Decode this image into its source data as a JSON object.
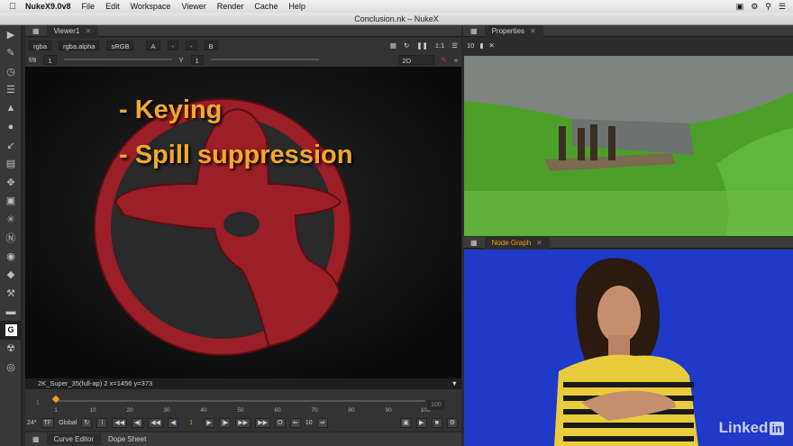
{
  "menubar": {
    "app_name": "NukeX9.0v8",
    "items": [
      "File",
      "Edit",
      "Workspace",
      "Viewer",
      "Render",
      "Cache",
      "Help"
    ]
  },
  "window_title": "Conclusion.nk – NukeX",
  "left_toolbar": {
    "tools": [
      "pointer-icon",
      "paint-icon",
      "clock-icon",
      "layers-icon",
      "draw-icon",
      "circle-icon",
      "corner-icon",
      "stack-icon",
      "move-icon",
      "cube-icon",
      "asterisk-icon",
      "d-icon",
      "eye-icon",
      "tag-icon",
      "wrench-icon",
      "film-icon",
      "g-icon",
      "nuke-icon",
      "other-icon"
    ]
  },
  "viewer": {
    "tab_label": "Viewer1",
    "channels": "rgba",
    "channel_alpha": "rgba.alpha",
    "colorspace": "sRGB",
    "input_a": "A",
    "input_a_value": "-",
    "input_b_value": "-",
    "input_b": "B",
    "zoom": "1:1",
    "fstop": "f/8",
    "gain_value": "1",
    "gamma_label": "Y",
    "gamma_value": "1",
    "mode": "2D",
    "slide_lines": [
      "- Keying",
      "- Spill suppression"
    ],
    "status": "2K_Super_35(full-ap) 2  x=1456 y=373"
  },
  "timeline": {
    "start": "1",
    "end": "100",
    "ticks": [
      "1",
      "10",
      "20",
      "30",
      "40",
      "50",
      "60",
      "70",
      "80",
      "90",
      "100"
    ],
    "playhead_fraction": 0.0,
    "fps": "24*",
    "tf": "TF",
    "scope": "Global",
    "current_frame": "1",
    "step": "10"
  },
  "bottom_tabs": [
    "Curve Editor",
    "Dope Sheet"
  ],
  "properties": {
    "tab_label": "Properties",
    "max_panels": "10"
  },
  "node_graph": {
    "tab_label": "Node Graph"
  },
  "watermark": {
    "brand": "Linked",
    "brand_in": "in"
  },
  "colors": {
    "accent": "#f39c12",
    "slide_text": "#f0a830",
    "logo_red": "#9c1e26",
    "green_screen": "#4ca02a",
    "blue_screen": "#1f39c8"
  }
}
